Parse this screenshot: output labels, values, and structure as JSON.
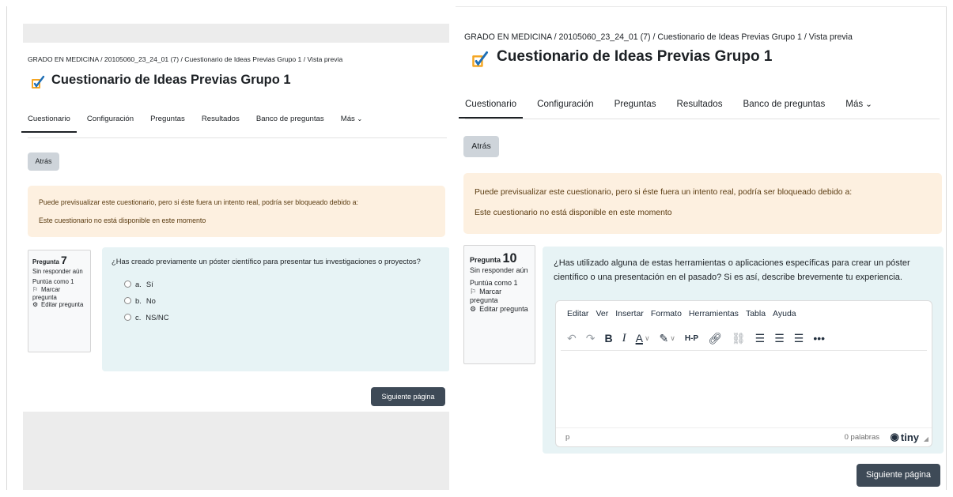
{
  "left": {
    "breadcrumb": "GRADO EN MEDICINA / 20105060_23_24_01 (7) / Cuestionario de Ideas Previas Grupo 1 / Vista previa",
    "title": "Cuestionario de Ideas Previas Grupo 1",
    "tabs": [
      "Cuestionario",
      "Configuración",
      "Preguntas",
      "Resultados",
      "Banco de preguntas",
      "Más"
    ],
    "back_label": "Atrás",
    "warning": {
      "line1": "Puede previsualizar este cuestionario, pero si éste fuera un intento real, podría ser bloqueado debido a:",
      "line2": "Este cuestionario no está disponible en este momento"
    },
    "question_info": {
      "label": "Pregunta",
      "number": "7",
      "status": "Sin responder aún",
      "points": "Puntúa como 1",
      "flag": "Marcar pregunta",
      "edit": "Editar pregunta"
    },
    "question_text": "¿Has creado previamente un póster científico para presentar tus investigaciones o proyectos?",
    "answers": [
      {
        "letter": "a.",
        "text": "Sí"
      },
      {
        "letter": "b.",
        "text": "No"
      },
      {
        "letter": "c.",
        "text": "NS/NC"
      }
    ],
    "next_label": "Siguiente página"
  },
  "right": {
    "breadcrumb": "GRADO EN MEDICINA / 20105060_23_24_01 (7) / Cuestionario de Ideas Previas Grupo 1 / Vista previa",
    "title": "Cuestionario de Ideas Previas Grupo 1",
    "tabs": [
      "Cuestionario",
      "Configuración",
      "Preguntas",
      "Resultados",
      "Banco de preguntas",
      "Más"
    ],
    "back_label": "Atrás",
    "warning": {
      "line1": "Puede previsualizar este cuestionario, pero si éste fuera un intento real, podría ser bloqueado debido a:",
      "line2": "Este cuestionario no está disponible en este momento"
    },
    "question_info": {
      "label": "Pregunta",
      "number": "10",
      "status": "Sin responder aún",
      "points": "Puntúa como 1",
      "flag": "Marcar pregunta",
      "edit": "Editar pregunta"
    },
    "question_text": "¿Has utilizado alguna de estas herramientas o aplicaciones específicas para crear un póster científico o una presentación en el pasado? Si es así, describe brevemente tu experiencia.",
    "editor": {
      "menu": [
        "Editar",
        "Ver",
        "Insertar",
        "Formato",
        "Herramientas",
        "Tabla",
        "Ayuda"
      ],
      "toolbar": {
        "bold": "B",
        "italic": "I",
        "text_color": "A",
        "h5p": "H-P",
        "more": "•••"
      },
      "path": "p",
      "word_count": "0 palabras",
      "brand": "tiny"
    },
    "next_label": "Siguiente página"
  }
}
